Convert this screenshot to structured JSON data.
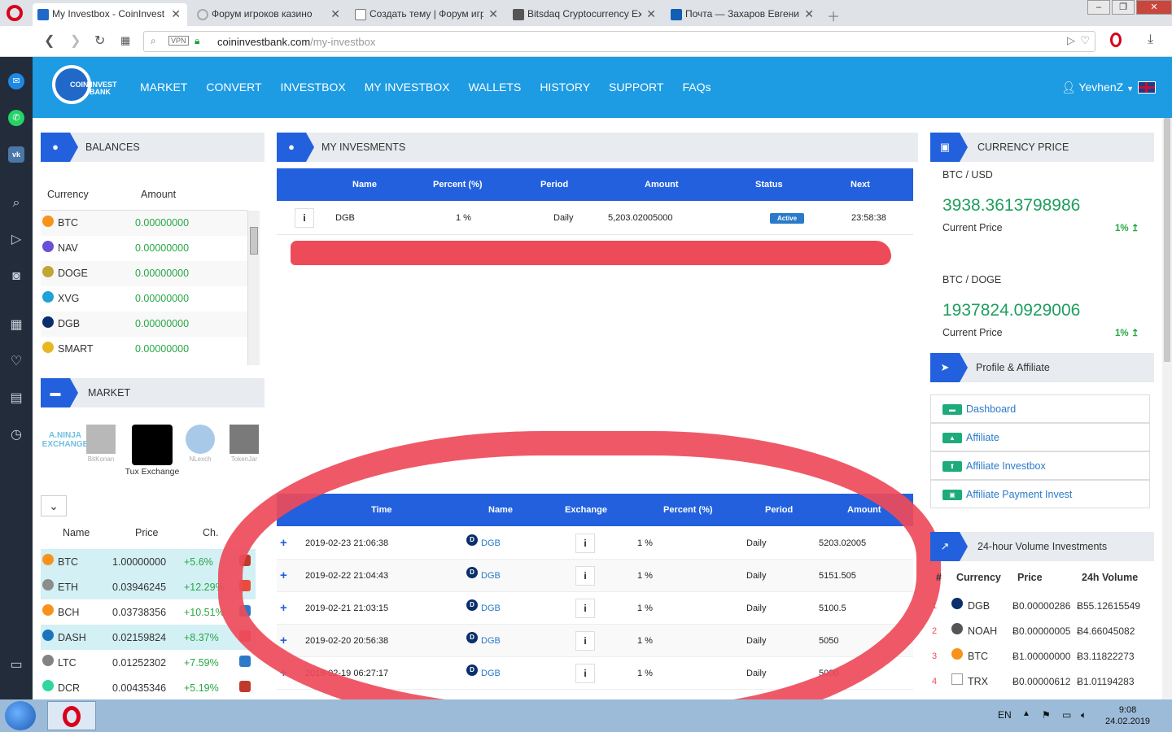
{
  "browser": {
    "tabs": [
      {
        "label": "My Investbox - CoinInvest",
        "active": true
      },
      {
        "label": "Форум игроков казино",
        "active": false
      },
      {
        "label": "Создать тему | Форум игр",
        "active": false
      },
      {
        "label": "Bitsdaq Cryptocurrency Ex",
        "active": false
      },
      {
        "label": "Почта — Захаров Евгени",
        "active": false
      }
    ],
    "vpn_label": "VPN",
    "url_host": "coininvestbank.com",
    "url_path": "/my-investbox"
  },
  "site": {
    "logo_text_1": "COIN INVEST",
    "logo_text_2": "BANK",
    "nav": [
      "MARKET",
      "CONVERT",
      "INVESTBOX",
      "MY INVESTBOX",
      "WALLETS",
      "HISTORY",
      "SUPPORT",
      "FAQs"
    ],
    "user": "YevhenZ"
  },
  "balances": {
    "title": "BALANCES",
    "col_currency": "Currency",
    "col_amount": "Amount",
    "rows": [
      {
        "name": "BTC",
        "amount": "0.00000000",
        "color": "#f7931a"
      },
      {
        "name": "NAV",
        "amount": "0.00000000",
        "color": "#6a4fd8"
      },
      {
        "name": "DOGE",
        "amount": "0.00000000",
        "color": "#c2a633"
      },
      {
        "name": "XVG",
        "amount": "0.00000000",
        "color": "#1ea2d8"
      },
      {
        "name": "DGB",
        "amount": "0.00000000",
        "color": "#0a2f6b"
      },
      {
        "name": "SMART",
        "amount": "0.00000000",
        "color": "#e8b722"
      }
    ]
  },
  "market": {
    "title": "MARKET",
    "exchanges": [
      "BitKonan",
      "Tux Exchange",
      "NLexch",
      "TokenJar"
    ],
    "exchange_logo_text": "A.NINJA EXCHANGE",
    "col_name": "Name",
    "col_price": "Price",
    "col_change": "Ch.",
    "rows": [
      {
        "name": "BTC",
        "price": "1.00000000",
        "change": "+5.6%",
        "color": "#f7931a",
        "icon_color": "#c0392b"
      },
      {
        "name": "ETH",
        "price": "0.03946245",
        "change": "+12.29%",
        "color": "#8c8c8c",
        "icon_color": "#e74c3c"
      },
      {
        "name": "BCH",
        "price": "0.03738356",
        "change": "+10.51%",
        "color": "#f7931a",
        "icon_color": "#2a7ac9"
      },
      {
        "name": "DASH",
        "price": "0.02159824",
        "change": "+8.37%",
        "color": "#1c75bc",
        "icon_color": "#e74c3c"
      },
      {
        "name": "LTC",
        "price": "0.01252302",
        "change": "+7.59%",
        "color": "#838383",
        "icon_color": "#2a7ac9"
      },
      {
        "name": "DCR",
        "price": "0.00435346",
        "change": "+5.19%",
        "color": "#2ed6a1",
        "icon_color": "#c0392b"
      }
    ]
  },
  "investments": {
    "title": "MY INVESMENTS",
    "columns": [
      "Name",
      "Percent (%)",
      "Period",
      "Amount",
      "Status",
      "Next"
    ],
    "row": {
      "info": "i",
      "name": "DGB",
      "percent": "1 %",
      "period": "Daily",
      "amount": "5,203.02005000",
      "status": "Active",
      "next": "23:58:38"
    }
  },
  "history": {
    "columns": [
      "Time",
      "Name",
      "Exchange",
      "Percent (%)",
      "Period",
      "Amount"
    ],
    "rows": [
      {
        "time": "2019-02-23 21:06:38",
        "name": "DGB",
        "percent": "1 %",
        "period": "Daily",
        "amount": "5203.02005"
      },
      {
        "time": "2019-02-22 21:04:43",
        "name": "DGB",
        "percent": "1 %",
        "period": "Daily",
        "amount": "5151.505"
      },
      {
        "time": "2019-02-21 21:03:15",
        "name": "DGB",
        "percent": "1 %",
        "period": "Daily",
        "amount": "5100.5"
      },
      {
        "time": "2019-02-20 20:56:38",
        "name": "DGB",
        "percent": "1 %",
        "period": "Daily",
        "amount": "5050"
      },
      {
        "time": "2019-02-19 06:27:17",
        "name": "DGB",
        "percent": "1 %",
        "period": "Daily",
        "amount": "5000"
      }
    ]
  },
  "currency_price": {
    "title": "CURRENCY PRICE",
    "items": [
      {
        "pair": "BTC / USD",
        "price": "3938.3613798986",
        "label": "Current Price",
        "change": "1% ↥"
      },
      {
        "pair": "BTC / DOGE",
        "price": "1937824.0929006",
        "label": "Current Price",
        "change": "1% ↥"
      }
    ]
  },
  "profile": {
    "title": "Profile & Affiliate",
    "links": [
      "Dashboard",
      "Affiliate",
      "Affiliate Investbox",
      "Affiliate Payment Invest"
    ]
  },
  "volume": {
    "title": "24-hour Volume Investments",
    "col_num": "#",
    "col_currency": "Currency",
    "col_price": "Price",
    "col_volume": "24h Volume",
    "rows": [
      {
        "num": "1",
        "name": "DGB",
        "price": "Ƀ0.00000286",
        "volume": "Ƀ55.12615549",
        "color": "#0a2f6b"
      },
      {
        "num": "2",
        "name": "NOAH",
        "price": "Ƀ0.00000005",
        "volume": "Ƀ4.66045082",
        "color": "#555555"
      },
      {
        "num": "3",
        "name": "BTC",
        "price": "Ƀ1.00000000",
        "volume": "Ƀ3.11822273",
        "color": "#f7931a"
      },
      {
        "num": "4",
        "name": "TRX",
        "price": "Ƀ0.00000612",
        "volume": "Ƀ1.01194283",
        "color": "#999999"
      }
    ]
  },
  "taskbar": {
    "lang": "EN",
    "time": "9:08",
    "date": "24.02.2019"
  }
}
